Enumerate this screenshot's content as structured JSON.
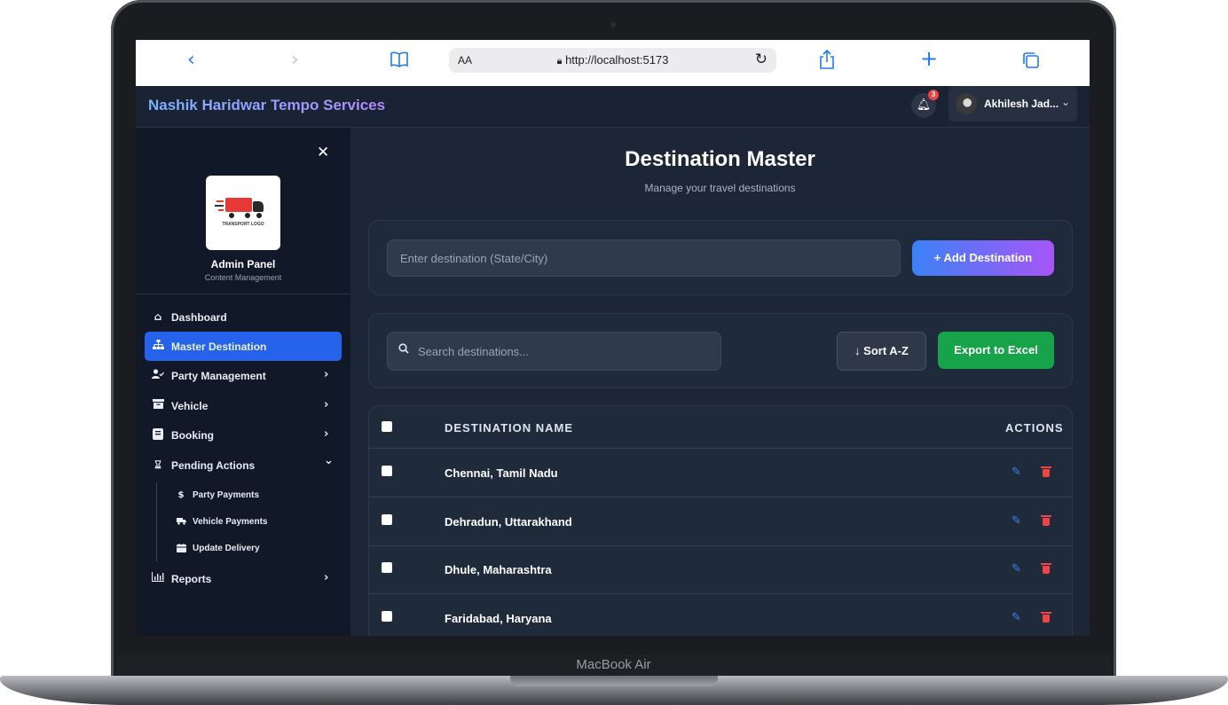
{
  "device": {
    "label": "MacBook Air"
  },
  "browser": {
    "reader_label": "AA",
    "url": "http://localhost:5173",
    "icons": [
      "chevron-left-icon",
      "chevron-right-icon",
      "book-icon",
      "lock-icon",
      "reload-icon",
      "share-icon",
      "plus-icon",
      "tabs-icon"
    ]
  },
  "header": {
    "brand": "Nashik Haridwar Tempo Services",
    "notifications_count": "3",
    "user_name": "Akhilesh Jad..."
  },
  "sidebar": {
    "logo_text": "TRANSPORT LOGO",
    "title": "Admin Panel",
    "subtitle": "Content Management",
    "items": [
      {
        "label": "Dashboard",
        "icon": "home-icon",
        "active": false,
        "chevron": ""
      },
      {
        "label": "Master Destination",
        "icon": "sitemap-icon",
        "active": true,
        "chevron": ""
      },
      {
        "label": "Party Management",
        "icon": "user-check-icon",
        "active": false,
        "chevron": "›"
      },
      {
        "label": "Vehicle",
        "icon": "archive-icon",
        "active": false,
        "chevron": "›"
      },
      {
        "label": "Booking",
        "icon": "book-icon",
        "active": false,
        "chevron": "›"
      },
      {
        "label": "Pending Actions",
        "icon": "hourglass-icon",
        "active": false,
        "chevron": "⌄"
      },
      {
        "label": "Reports",
        "icon": "chart-icon",
        "active": false,
        "chevron": "›"
      }
    ],
    "sub_items": [
      {
        "label": "Party Payments",
        "icon": "dollar-icon"
      },
      {
        "label": "Vehicle Payments",
        "icon": "truck-icon"
      },
      {
        "label": "Update Delivery",
        "icon": "calendar-icon"
      }
    ]
  },
  "main": {
    "title": "Destination Master",
    "subtitle": "Manage your travel destinations",
    "add_input_placeholder": "Enter destination (State/City)",
    "add_button": "+ Add Destination",
    "search_placeholder": "Search destinations...",
    "sort_button": "↓ Sort A-Z",
    "export_button": "Export to Excel",
    "table": {
      "headers": [
        "DESTINATION NAME",
        "ACTIONS"
      ],
      "rows": [
        "Chennai, Tamil Nadu",
        "Dehradun, Uttarakhand",
        "Dhule, Maharashtra",
        "Faridabad, Haryana"
      ]
    }
  }
}
